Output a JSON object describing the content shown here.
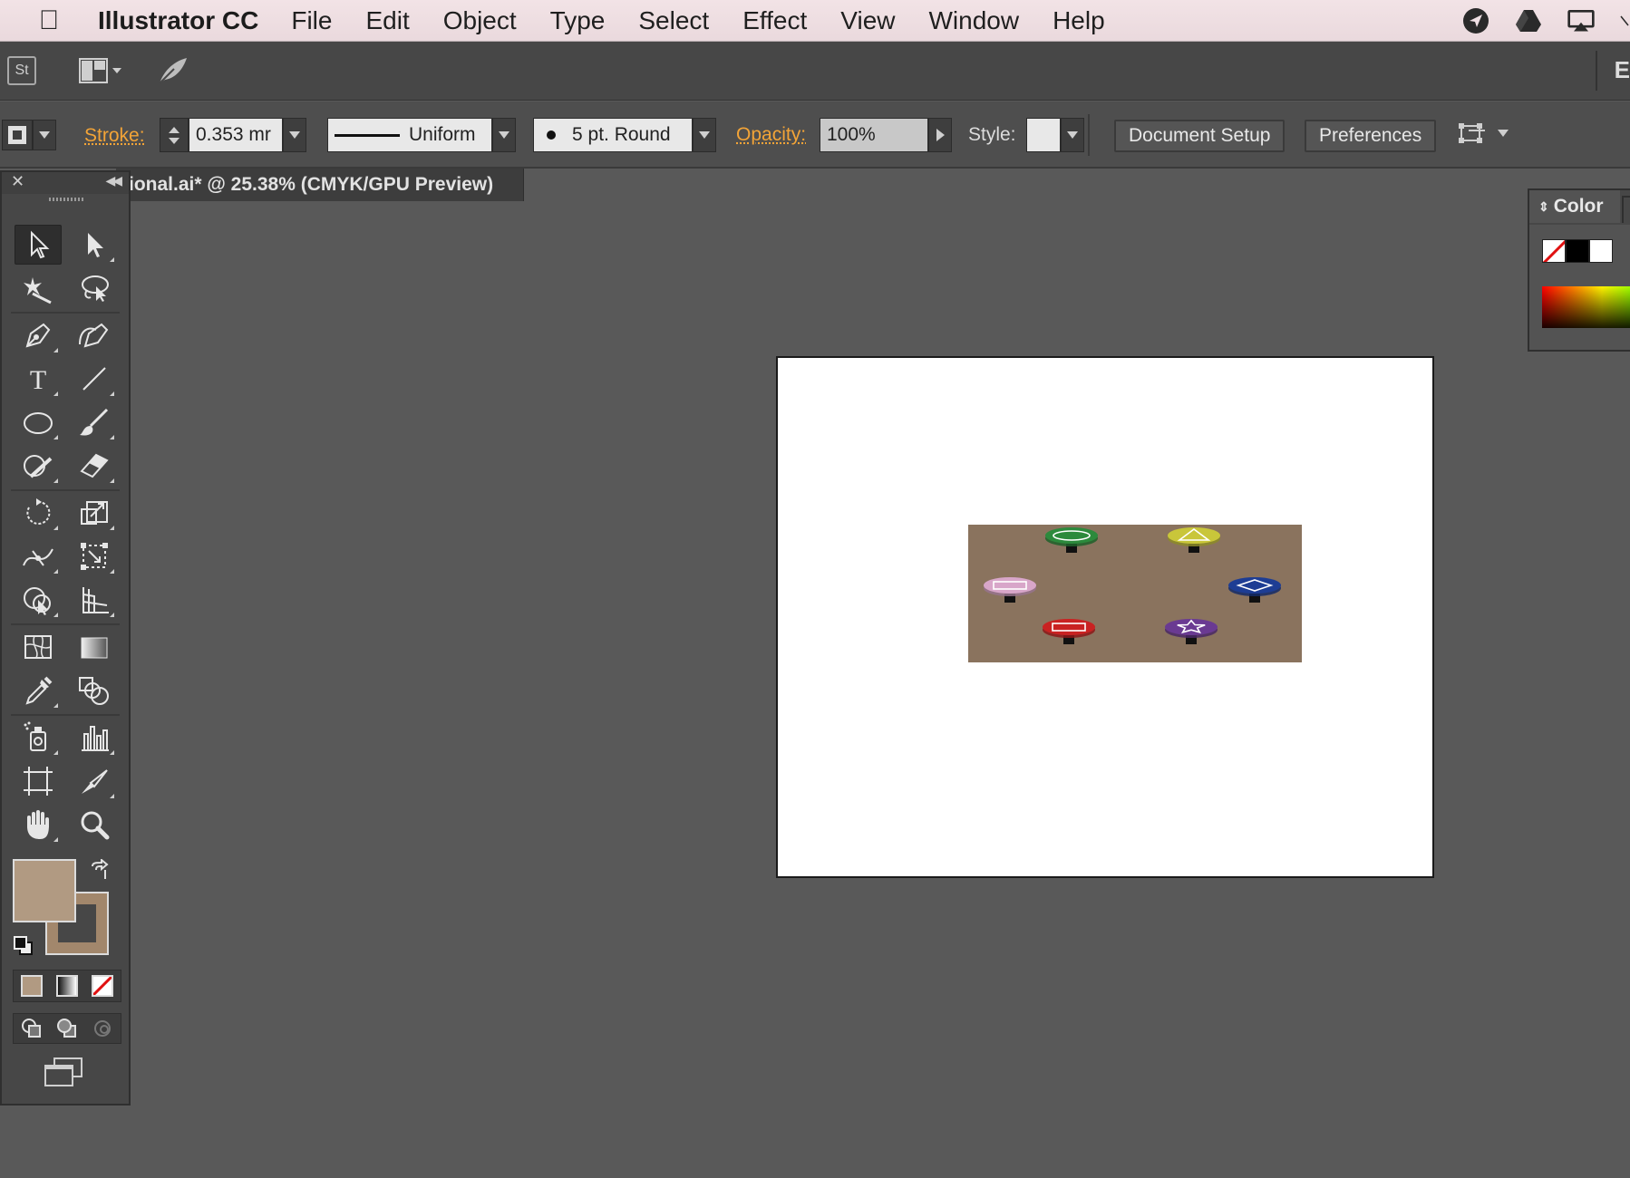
{
  "menubar": {
    "app_name": "Illustrator CC",
    "items": [
      "File",
      "Edit",
      "Object",
      "Type",
      "Select",
      "Effect",
      "View",
      "Window",
      "Help"
    ],
    "tray_icons": [
      "navigation-icon",
      "drive-icon",
      "airplay-icon"
    ]
  },
  "appbar": {
    "stock_label": "St",
    "edge_label": "E"
  },
  "controlbar": {
    "stroke_label": "Stroke:",
    "stroke_value": "0.353 mr",
    "profile_label": "Uniform",
    "brush_label": "5 pt. Round",
    "opacity_label": "Opacity:",
    "opacity_value": "100%",
    "style_label": "Style:",
    "doc_setup_label": "Document Setup",
    "preferences_label": "Preferences"
  },
  "document": {
    "tab_title": "ional.ai* @ 25.38% (CMYK/GPU Preview)"
  },
  "tools_panel": {
    "fill_color": "#b19a82",
    "stroke_color": "#a2876c"
  },
  "artwork": {
    "background_color": "#8a735e",
    "buttons": [
      {
        "color": "#2c8a3c",
        "symbol": "ellipse"
      },
      {
        "color": "#c9c63a",
        "symbol": "triangle"
      },
      {
        "color": "#d8a6c9",
        "symbol": "rectangle"
      },
      {
        "color": "#1d3d94",
        "symbol": "diamond"
      },
      {
        "color": "#c92222",
        "symbol": "rectangle"
      },
      {
        "color": "#6a3a92",
        "symbol": "star"
      }
    ]
  },
  "color_panel": {
    "title": "Color"
  }
}
